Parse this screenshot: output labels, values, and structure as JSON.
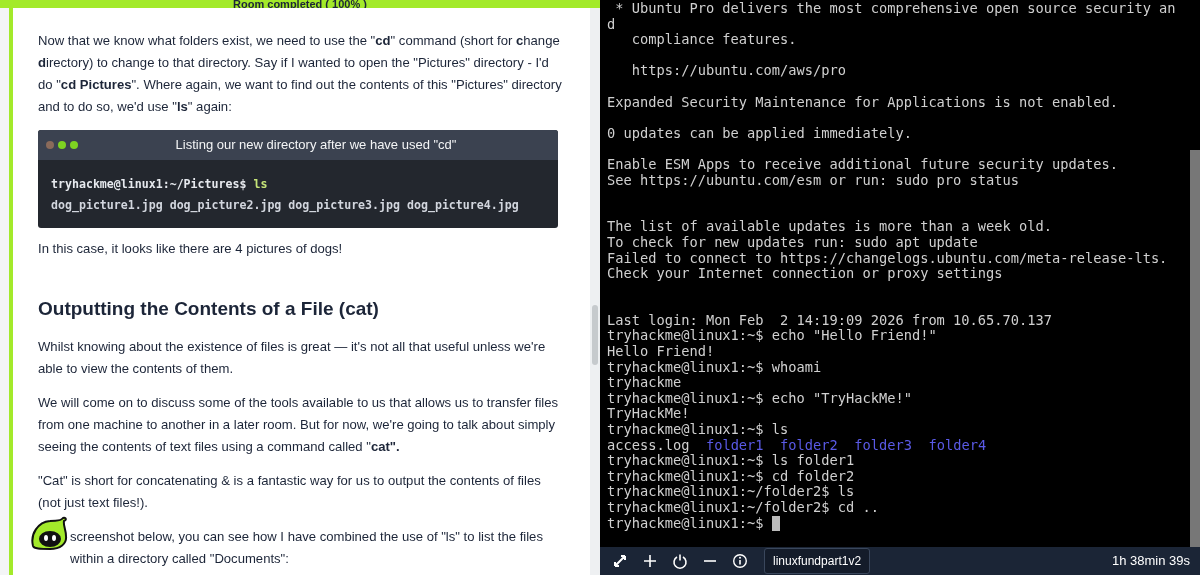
{
  "room_banner": {
    "text": "Room completed ( 100% )"
  },
  "article": {
    "intro": "Now that we know what folders exist, we need to use the \"**cd**\" command (short for **c**hange **d**irectory) to change to that directory. Say if I wanted to open the \"Pictures\" directory - I'd do \"**cd Pictures**\". Where again, we want to find out the contents of this \"Pictures\" directory and to do so, we'd use \"**ls**\" again:",
    "code_block": {
      "title": "Listing our new directory after we have used \"cd\"",
      "lines": [
        [
          {
            "text": "tryhackme@linux1:~/Pictures$",
            "kind": "prompt"
          },
          {
            "text": " ls",
            "kind": "command"
          }
        ],
        [
          {
            "text": "dog_picture1.jpg dog_picture2.jpg dog_picture3.jpg dog_picture4.jpg",
            "kind": "output"
          }
        ]
      ]
    },
    "after_code": "In this case, it looks like there are 4 pictures of dogs!",
    "heading": "Outputting the Contents of a File (cat)",
    "paragraphs": [
      "Whilst knowing about the existence of files is great — it's not all that useful unless we're able to view the contents of them.",
      "We will come on to discuss some of the tools available to us that allows us to transfer files from one machine to another in a later room. But for now, we're going to talk about simply seeing the contents of text files using a command called \"**cat\".**",
      "\"Cat\" is short for concatenating & is a fantastic way for us to output the contents of files (not just text files!)."
    ],
    "covered_paragraph": "screenshot below, you can see how I have combined the use of \"ls\" to list the files within a directory called \"Documents\":"
  },
  "terminal": {
    "lines": [
      {
        "kind": "text",
        "text": " * Ubuntu Pro delivers the most comprehensive open source security an"
      },
      {
        "kind": "text",
        "text": "d"
      },
      {
        "kind": "text",
        "text": "   compliance features."
      },
      {
        "kind": "blank"
      },
      {
        "kind": "text",
        "text": "   https://ubuntu.com/aws/pro"
      },
      {
        "kind": "blank"
      },
      {
        "kind": "text",
        "text": "Expanded Security Maintenance for Applications is not enabled."
      },
      {
        "kind": "blank"
      },
      {
        "kind": "text",
        "text": "0 updates can be applied immediately."
      },
      {
        "kind": "blank"
      },
      {
        "kind": "text",
        "text": "Enable ESM Apps to receive additional future security updates."
      },
      {
        "kind": "text",
        "text": "See https://ubuntu.com/esm or run: sudo pro status"
      },
      {
        "kind": "blank"
      },
      {
        "kind": "blank"
      },
      {
        "kind": "text",
        "text": "The list of available updates is more than a week old."
      },
      {
        "kind": "text",
        "text": "To check for new updates run: sudo apt update"
      },
      {
        "kind": "text",
        "text": "Failed to connect to https://changelogs.ubuntu.com/meta-release-lts."
      },
      {
        "kind": "text",
        "text": "Check your Internet connection or proxy settings"
      },
      {
        "kind": "blank"
      },
      {
        "kind": "blank"
      },
      {
        "kind": "text",
        "text": "Last login: Mon Feb  2 14:19:09 2026 from 10.65.70.137"
      },
      {
        "kind": "text",
        "text": "tryhackme@linux1:~$ echo \"Hello Friend!\""
      },
      {
        "kind": "text",
        "text": "Hello Friend!"
      },
      {
        "kind": "text",
        "text": "tryhackme@linux1:~$ whoami"
      },
      {
        "kind": "text",
        "text": "tryhackme"
      },
      {
        "kind": "text",
        "text": "tryhackme@linux1:~$ echo \"TryHackMe!\""
      },
      {
        "kind": "text",
        "text": "TryHackMe!"
      },
      {
        "kind": "text",
        "text": "tryhackme@linux1:~$ ls"
      },
      {
        "kind": "listing",
        "entries": [
          {
            "text": "access.log",
            "kind": "file"
          },
          {
            "text": "folder1",
            "kind": "directory"
          },
          {
            "text": "folder2",
            "kind": "directory"
          },
          {
            "text": "folder3",
            "kind": "directory"
          },
          {
            "text": "folder4",
            "kind": "directory"
          }
        ]
      },
      {
        "kind": "text",
        "text": "tryhackme@linux1:~$ ls folder1"
      },
      {
        "kind": "text",
        "text": "tryhackme@linux1:~$ cd folder2"
      },
      {
        "kind": "text",
        "text": "tryhackme@linux1:~/folder2$ ls"
      },
      {
        "kind": "text",
        "text": "tryhackme@linux1:~/folder2$ cd .."
      },
      {
        "kind": "text",
        "text": "tryhackme@linux1:~$",
        "cursor": true
      }
    ]
  },
  "toolbar": {
    "tab": "linuxfundpart1v2",
    "timer": "1h 38min 39s"
  }
}
